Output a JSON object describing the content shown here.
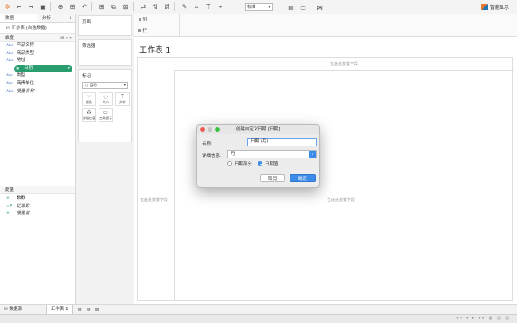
{
  "toolbar": {
    "size_select": "标准",
    "show_me": "智能显示"
  },
  "left_pane": {
    "tabs": [
      "数据",
      "分析"
    ],
    "datasource": "汇总表 (自选数据)",
    "dimensions_header": "维度",
    "dimensions": [
      {
        "type": "Abc",
        "name": "产品名称"
      },
      {
        "type": "Abc",
        "name": "商品类型"
      },
      {
        "type": "Abc",
        "name": "地址"
      },
      {
        "type": "date",
        "name": "日期"
      },
      {
        "type": "Abc",
        "name": "类型"
      },
      {
        "type": "Abc",
        "name": "商贵单位"
      },
      {
        "type": "Abc",
        "name": "度量名称"
      }
    ],
    "measures_header": "度量",
    "measures": [
      {
        "type": "#",
        "name": "数数"
      },
      {
        "type": "=#",
        "name": "记录数"
      },
      {
        "type": "#",
        "name": "度量值"
      }
    ]
  },
  "shelves": {
    "pages": "页面",
    "filters": "筛选器",
    "marks": "标记",
    "mark_type": "自动",
    "mark_buttons": [
      "颜色",
      "大小",
      "文本",
      "详细信息",
      "工具提示"
    ],
    "columns": "列",
    "rows": "行"
  },
  "sheet": {
    "title": "工作表 1",
    "drop_field": "在此处放置字段"
  },
  "bottom": {
    "datasource_tab": "数据源",
    "sheet_tab": "工作表 1"
  },
  "dialog": {
    "title": "创建自定义日期 [日期]",
    "name_label": "名称:",
    "name_value": "日期 (月)",
    "detail_label": "详细信息:",
    "detail_value": "月",
    "radio_date_part": "日期部分",
    "radio_date_value": "日期值",
    "selected_radio": "日期值",
    "cancel_label": "取消",
    "ok_label": "确定"
  }
}
